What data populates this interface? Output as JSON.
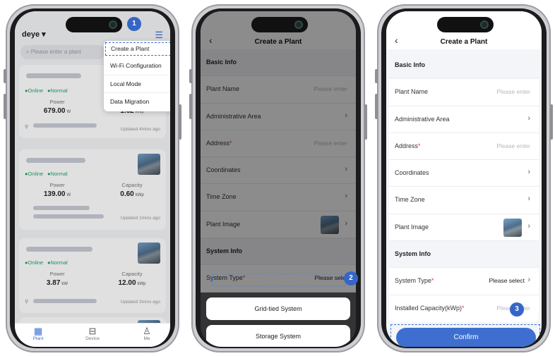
{
  "screen1": {
    "brand": "deye ▾",
    "search_placeholder": "Please enter a plant",
    "menu": [
      "Create a Plant",
      "Wi-Fi Configuration",
      "Local Mode",
      "Data Migration"
    ],
    "plants": [
      {
        "status": "●Online",
        "condition": "●Normal",
        "power_label": "Power",
        "power_value": "679.00",
        "power_unit": "W",
        "capacity_value": "1.62",
        "capacity_unit": "kWp",
        "updated": "Updated  4mins ago"
      },
      {
        "status": "●Online",
        "condition": "●Normal",
        "power_label": "Power",
        "power_value": "139.00",
        "power_unit": "W",
        "capacity_label": "Capacity",
        "capacity_value": "0.60",
        "capacity_unit": "kWp",
        "updated": "Updated  1mins ago"
      },
      {
        "status": "●Online",
        "condition": "●Normal",
        "power_label": "Power",
        "power_value": "3.87",
        "power_unit": "kW",
        "capacity_label": "Capacity",
        "capacity_value": "12.00",
        "capacity_unit": "kWp",
        "updated": "Updated  3mins ago"
      }
    ],
    "tabs": [
      "Plant",
      "Device",
      "Me"
    ],
    "badge": "1"
  },
  "screen2": {
    "title": "Create a Plant",
    "section_basic": "Basic Info",
    "plant_name": "Plant Name",
    "admin_area": "Administrative Area",
    "address": "Address",
    "coordinates": "Coordinates",
    "time_zone": "Time Zone",
    "plant_image": "Plant Image",
    "section_system": "System Info",
    "system_type": "System Type",
    "please_enter": "Please enter",
    "please_select": "Please select",
    "option_grid": "Grid-tied System",
    "option_storage": "Storage System",
    "badge": "2"
  },
  "screen3": {
    "title": "Create a Plant",
    "section_basic": "Basic Info",
    "plant_name": "Plant Name",
    "admin_area": "Administrative Area",
    "address": "Address",
    "coordinates": "Coordinates",
    "time_zone": "Time Zone",
    "plant_image": "Plant Image",
    "section_system": "System Info",
    "system_type": "System Type",
    "installed_capacity": "Installed Capacity(kWp)",
    "please_enter": "Please enter",
    "please_select": "Please select",
    "confirm": "Confirm",
    "badge": "3"
  },
  "colors": {
    "accent": "#3e6fd0",
    "online": "#21a56b",
    "required": "#e23b3b"
  },
  "icons": {
    "back": "chevron-left-icon",
    "chevron": "chevron-right-icon",
    "menu": "list-menu-icon",
    "search": "search-icon",
    "location": "location-pin-icon"
  }
}
